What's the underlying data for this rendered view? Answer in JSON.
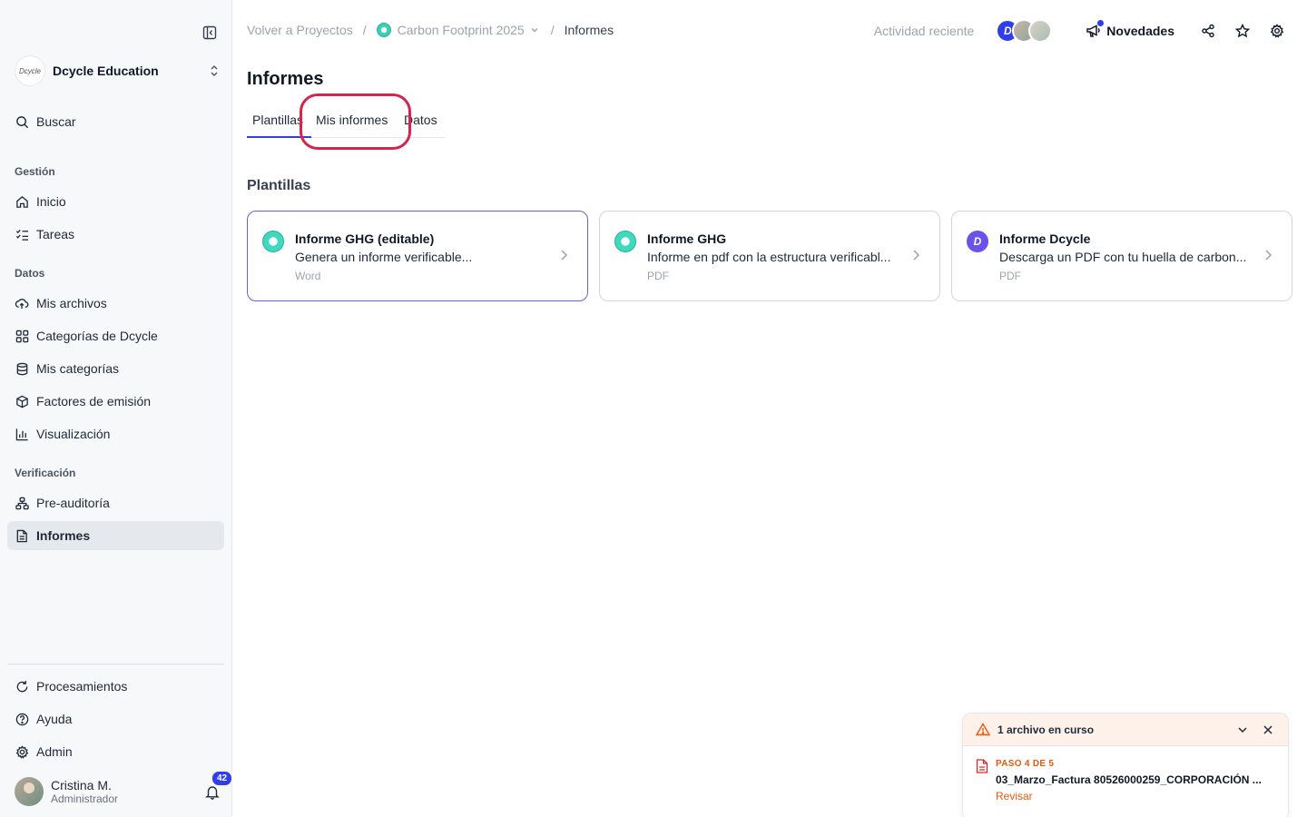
{
  "org": {
    "name": "Dcycle Education",
    "logo_text": "Dcycle"
  },
  "sidebar": {
    "search": "Buscar",
    "sections": {
      "gestion": "Gestión",
      "datos": "Datos",
      "verificacion": "Verificación"
    },
    "items": {
      "inicio": "Inicio",
      "tareas": "Tareas",
      "mis_archivos": "Mis archivos",
      "categorias_dcycle": "Categorías de Dcycle",
      "mis_categorias": "Mis categorías",
      "factores": "Factores de emisión",
      "visualizacion": "Visualización",
      "preauditoria": "Pre-auditoría",
      "informes": "Informes"
    },
    "bottom": {
      "procesamientos": "Procesamientos",
      "ayuda": "Ayuda",
      "admin": "Admin"
    },
    "user": {
      "name": "Cristina M.",
      "role": "Administrador",
      "notifications": "42"
    }
  },
  "topbar": {
    "back": "Volver a Proyectos",
    "project": "Carbon Footprint 2025",
    "current": "Informes",
    "activity": "Actividad reciente",
    "avatar_initial": "D",
    "novedades": "Novedades"
  },
  "main": {
    "title": "Informes",
    "tabs": [
      "Plantillas",
      "Mis informes",
      "Datos"
    ],
    "section_title": "Plantillas",
    "cards": [
      {
        "title": "Informe GHG (editable)",
        "desc": "Genera un informe verificable...",
        "type": "Word"
      },
      {
        "title": "Informe GHG",
        "desc": "Informe en pdf con la estructura verificabl...",
        "type": "PDF"
      },
      {
        "title": "Informe Dcycle",
        "desc": "Descarga un PDF con tu huella de carbon...",
        "type": "PDF",
        "icon_letter": "D"
      }
    ]
  },
  "upload": {
    "title": "1 archivo en curso",
    "step": "PASO 4 DE 5",
    "file": "03_Marzo_Factura 80526000259_CORPORACIÓN ...",
    "action": "Revisar"
  }
}
